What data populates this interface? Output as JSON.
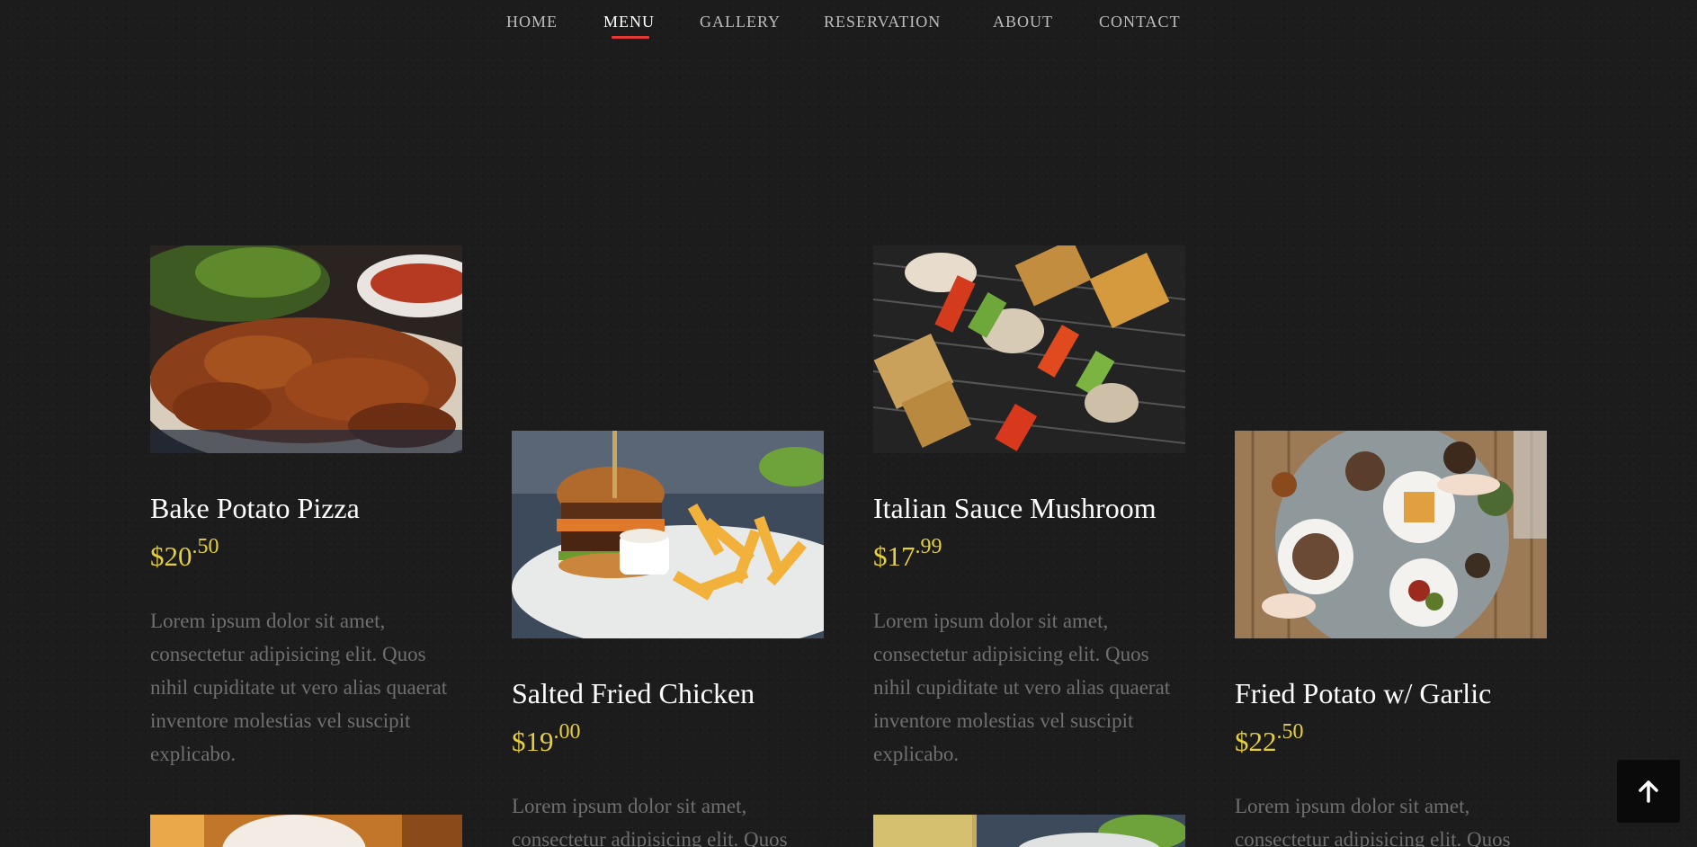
{
  "nav": {
    "items": [
      {
        "label": "HOME"
      },
      {
        "label": "MENU"
      },
      {
        "label": "GALLERY"
      },
      {
        "label": "RESERVATION"
      },
      {
        "label": "ABOUT"
      },
      {
        "label": "CONTACT"
      }
    ],
    "active": "MENU"
  },
  "menu": {
    "items": [
      {
        "name": "Bake Potato Pizza",
        "price_main": "$20",
        "price_cents": ".50",
        "description": "Lorem ipsum dolor sit amet, consectetur adipisicing elit. Quos nihil cupiditate ut vero alias quaerat inventore molestias vel suscipit explicabo."
      },
      {
        "name": "Salted Fried Chicken",
        "price_main": "$19",
        "price_cents": ".00",
        "description": "Lorem ipsum dolor sit amet, consectetur adipisicing elit. Quos"
      },
      {
        "name": "Italian Sauce Mushroom",
        "price_main": "$17",
        "price_cents": ".99",
        "description": "Lorem ipsum dolor sit amet, consectetur adipisicing elit. Quos nihil cupiditate ut vero alias quaerat inventore molestias vel suscipit explicabo."
      },
      {
        "name": "Fried Potato w/ Garlic",
        "price_main": "$22",
        "price_cents": ".50",
        "description": "Lorem ipsum dolor sit amet, consectetur adipisicing elit. Quos"
      }
    ]
  },
  "colors": {
    "background": "#1c1c1c",
    "accent_underline": "#e53935",
    "price": "#e6cf3c",
    "description": "#6f6f6f"
  },
  "back_to_top": {
    "icon": "arrow-up-icon"
  }
}
